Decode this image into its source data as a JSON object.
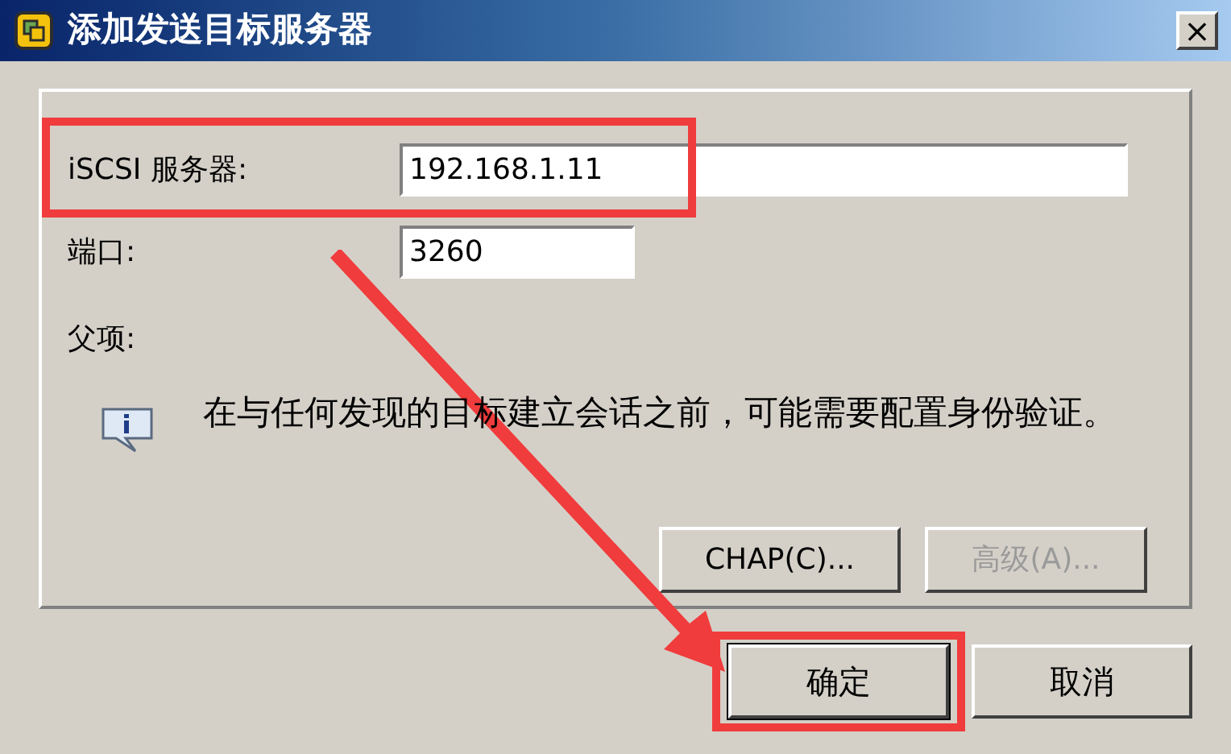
{
  "window": {
    "title": "添加发送目标服务器",
    "close": "×"
  },
  "fields": [
    {
      "label": "iSCSI 服务器:",
      "value": "192.168.1.11",
      "wide": true,
      "highlighted": true
    },
    {
      "label": "端口:",
      "value": "3260",
      "wide": false,
      "highlighted": false
    }
  ],
  "parent_label": "父项:",
  "info": "在与任何发现的目标建立会话之前，可能需要配置身份验证。",
  "group_buttons": [
    {
      "label": "CHAP(C)...",
      "disabled": false
    },
    {
      "label": "高级(A)...",
      "disabled": true
    }
  ],
  "dialog_buttons": [
    {
      "label": "确定",
      "highlighted": true,
      "default": true
    },
    {
      "label": "取消",
      "highlighted": false,
      "default": false
    }
  ]
}
